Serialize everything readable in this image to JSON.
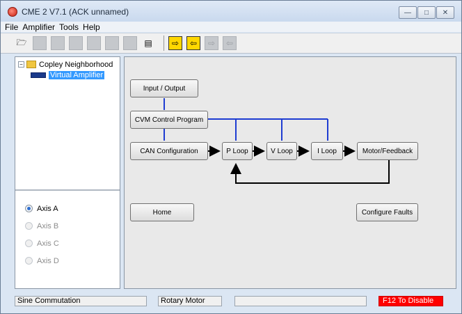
{
  "window": {
    "title": "CME 2 V7.1 (ACK unnamed)",
    "minimize_glyph": "—",
    "maximize_glyph": "□",
    "close_glyph": "✕"
  },
  "menu": [
    "File",
    "Amplifier",
    "Tools",
    "Help"
  ],
  "toolbar": {
    "icons": [
      "open-folder-icon",
      "chart-icon",
      "control-icon",
      "tune-icon",
      "scope-icon",
      "panel-icon",
      "dip-icon",
      "document-icon",
      "download-icon",
      "upload-icon",
      "save-to-device-icon",
      "restore-from-device-icon"
    ],
    "glyphs": {
      "open": "🗁",
      "document": "▤",
      "download": "⇨",
      "upload": "⇦",
      "save_device": "⇨",
      "restore_device": "⇦"
    }
  },
  "tree": {
    "root_label": "Copley Neighborhood",
    "toggle_glyph": "−",
    "child_label": "Virtual Amplifier"
  },
  "axes": [
    {
      "label": "Axis A",
      "checked": true,
      "enabled": true
    },
    {
      "label": "Axis B",
      "checked": false,
      "enabled": false
    },
    {
      "label": "Axis C",
      "checked": false,
      "enabled": false
    },
    {
      "label": "Axis D",
      "checked": false,
      "enabled": false
    }
  ],
  "diagram": {
    "input_output": "Input / Output",
    "cvm_control": "CVM Control Program",
    "can_config": "CAN Configuration",
    "p_loop": "P Loop",
    "v_loop": "V Loop",
    "i_loop": "I Loop",
    "motor_feedback": "Motor/Feedback",
    "home": "Home",
    "configure_faults": "Configure Faults",
    "line_color": "#1e3cd2",
    "arrow_color": "#000000"
  },
  "status": {
    "commutation": "Sine Commutation",
    "motor_type": "Rotary Motor",
    "middle": "",
    "f12": "F12 To Disable"
  }
}
